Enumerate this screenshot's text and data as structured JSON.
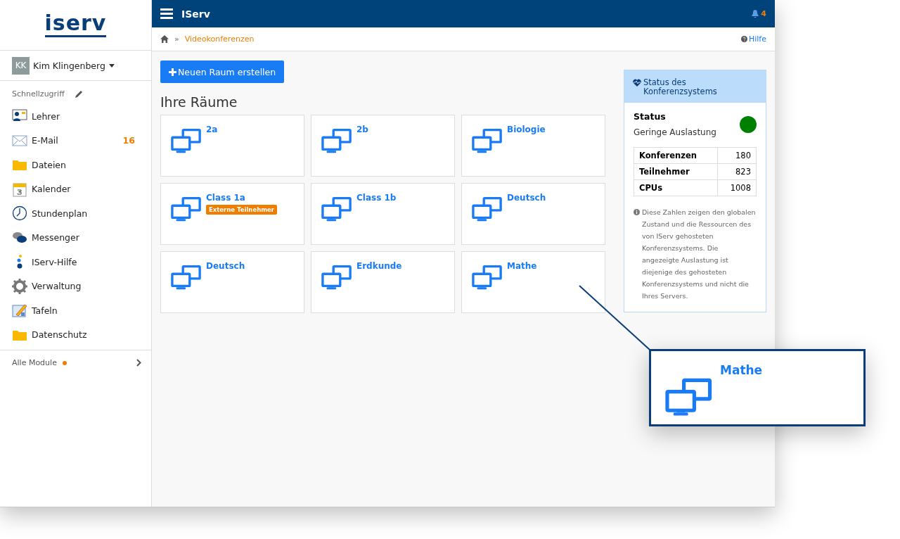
{
  "logo": {
    "text": "iserv"
  },
  "user": {
    "initials": "KK",
    "name": "Kim Klingenberg"
  },
  "quick_access": {
    "label": "Schnellzugriff"
  },
  "sidebar": {
    "items": [
      {
        "label": "Lehrer",
        "kind": "teacher"
      },
      {
        "label": "E-Mail",
        "kind": "mail",
        "count": "16"
      },
      {
        "label": "Dateien",
        "kind": "folder"
      },
      {
        "label": "Kalender",
        "kind": "calendar"
      },
      {
        "label": "Stundenplan",
        "kind": "clock"
      },
      {
        "label": "Messenger",
        "kind": "chat"
      },
      {
        "label": "IServ-Hilfe",
        "kind": "help"
      },
      {
        "label": "Verwaltung",
        "kind": "gear"
      },
      {
        "label": "Tafeln",
        "kind": "board"
      },
      {
        "label": "Datenschutz",
        "kind": "folder"
      }
    ],
    "all_modules": {
      "label": "Alle Module",
      "dot": true
    }
  },
  "header": {
    "title": "IServ",
    "notifications": "4"
  },
  "breadcrumb": {
    "separator": "»",
    "current": "Videokonferenzen",
    "help": "Hilfe"
  },
  "new_room_button": "Neuen Raum erstellen",
  "rooms_heading": "Ihre Räume",
  "rooms": [
    {
      "name": "2a"
    },
    {
      "name": "2b"
    },
    {
      "name": "Biologie"
    },
    {
      "name": "Class 1a",
      "badge": "Externe Teilnehmer"
    },
    {
      "name": "Class 1b"
    },
    {
      "name": "Deutsch"
    },
    {
      "name": "Deutsch"
    },
    {
      "name": "Erdkunde"
    },
    {
      "name": "Mathe"
    }
  ],
  "status_panel": {
    "title": "Status des Konferenzsystems",
    "status_label": "Status",
    "status_text": "Geringe Auslastung",
    "color": "#008000",
    "stats": [
      {
        "label": "Konferenzen",
        "value": "180"
      },
      {
        "label": "Teilnehmer",
        "value": "823"
      },
      {
        "label": "CPUs",
        "value": "1008"
      }
    ],
    "note": "Diese Zahlen zeigen den globalen Zustand und die Ressourcen des von IServ gehosteten Konferenzsystems. Die angezeigte Auslastung ist diejenige des gehosteten Konferenzsystems und nicht die Ihres Servers."
  },
  "callout": {
    "name": "Mathe"
  }
}
